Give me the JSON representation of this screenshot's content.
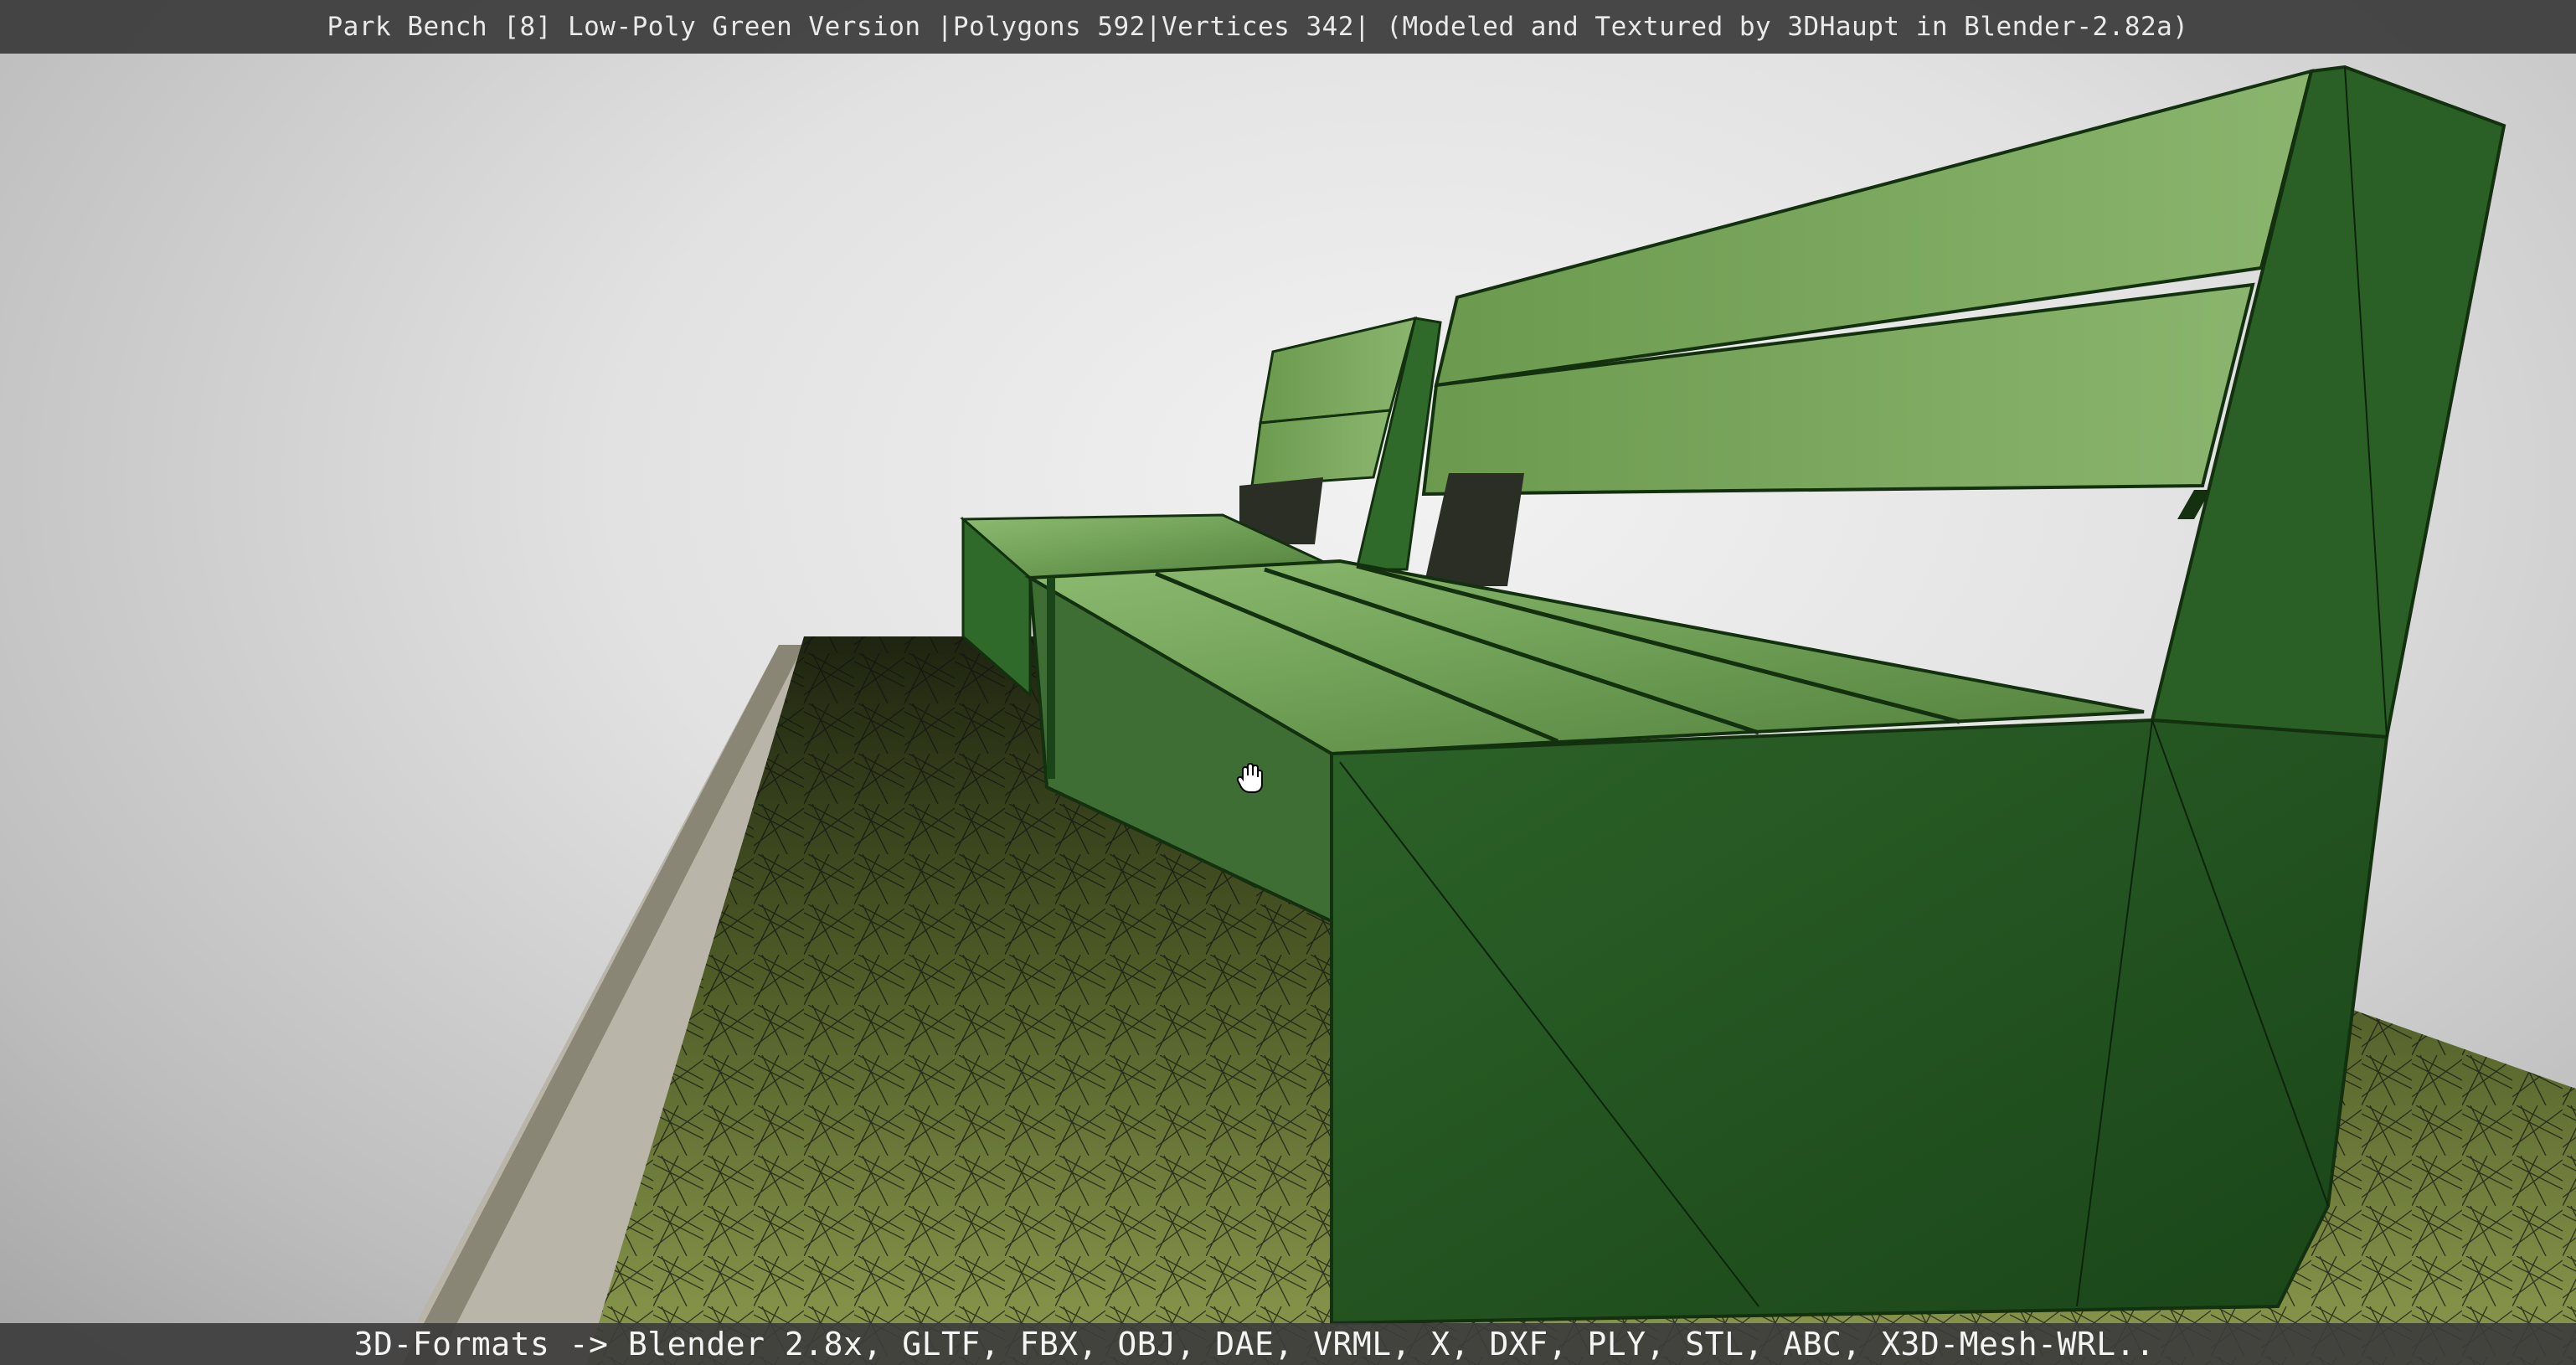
{
  "viewer": {
    "title": "Park Bench [8] Low-Poly Green Version |Polygons 592|Vertices 342| (Modeled and Textured by 3DHaupt in Blender-2.82a)",
    "formats": "3D-Formats -> Blender 2.8x, GLTF, FBX, OBJ, DAE, VRML, X, DXF, PLY, STL, ABC, X3D-Mesh-WRL..",
    "cursor": "grab-hand-icon"
  },
  "colors": {
    "bench_dark": "#1f4a1f",
    "bench_mid": "#2f6a2a",
    "wood_light": "#7fae62",
    "grass": "#6b7a35",
    "bar_bg": "#3a3a3a"
  }
}
